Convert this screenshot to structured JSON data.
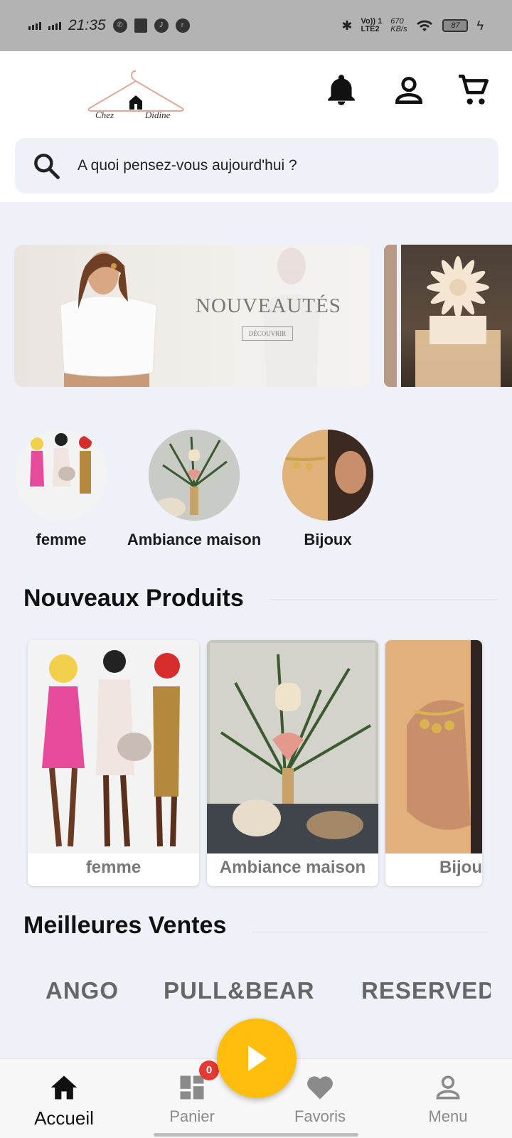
{
  "status_bar": {
    "time": "21:35",
    "network": "LTE2",
    "network_top": "Vo)) 1",
    "speed_value": "670",
    "speed_unit": "KB/s",
    "battery": "87"
  },
  "header": {
    "logo_text": "Chez Didine",
    "icons": [
      "bell-icon",
      "account-icon",
      "cart-icon"
    ]
  },
  "search": {
    "placeholder": "A quoi pensez-vous aujourd'hui ?"
  },
  "banner": {
    "title": "NOUVEAUTÉS",
    "cta": "DÉCOUVRIR"
  },
  "categories": [
    {
      "label": "femme"
    },
    {
      "label": "Ambiance maison"
    },
    {
      "label": "Bijoux"
    }
  ],
  "new_products": {
    "title": "Nouveaux Produits",
    "items": [
      {
        "name": "femme"
      },
      {
        "name": "Ambiance maison"
      },
      {
        "name": "Bijoux"
      }
    ]
  },
  "best_sellers": {
    "title": "Meilleures Ventes",
    "brands": [
      "ANGO",
      "PULL&BEAR",
      "RESERVED"
    ]
  },
  "bottom_nav": {
    "items": [
      {
        "label": "Accueil",
        "icon": "home-icon",
        "active": true
      },
      {
        "label": "Panier",
        "icon": "dashboard-icon",
        "active": false
      },
      {
        "label": "Favoris",
        "icon": "heart-icon",
        "active": false
      },
      {
        "label": "Menu",
        "icon": "person-icon",
        "active": false
      }
    ],
    "cart_badge": "0"
  },
  "colors": {
    "accent": "#ffbd0d",
    "badge": "#e53935",
    "background": "#eef2f8"
  }
}
